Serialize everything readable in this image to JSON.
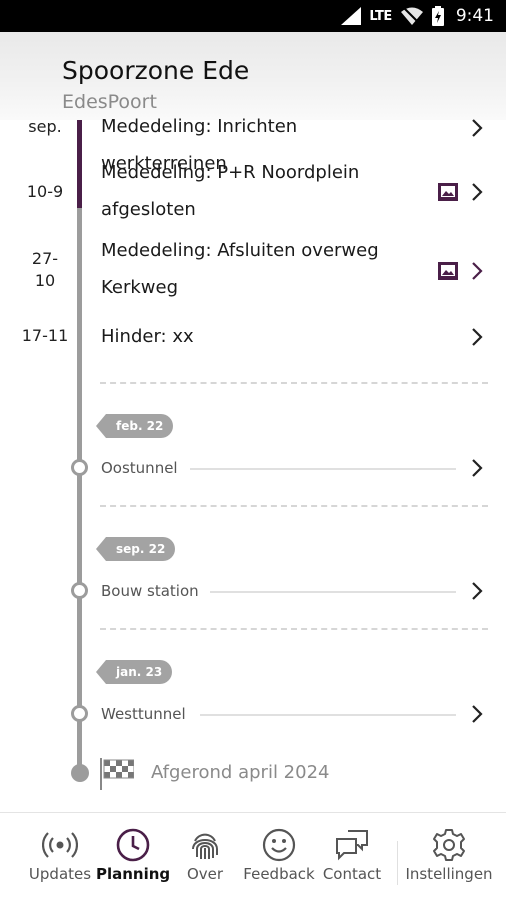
{
  "status_bar": {
    "network": "LTE",
    "time": "9:41"
  },
  "header": {
    "title": "Spoorzone Ede",
    "subtitle": "EdesPoort"
  },
  "updates": [
    {
      "date": "sep.",
      "title": "Mededeling: Inrichten werkterreinen",
      "has_image": false
    },
    {
      "date": "10-9",
      "title_line1": "Mededeling: P+R Noordplein",
      "title_line2": "afgesloten",
      "has_image": true
    },
    {
      "date_line1": "27-",
      "date_line2": "10",
      "title_line1": "Mededeling: Afsluiten overweg",
      "title_line2": "Kerkweg",
      "has_image": true
    },
    {
      "date": "17-11",
      "title": "Hinder: xx",
      "has_image": false
    }
  ],
  "milestones": [
    {
      "tag": "feb. 22",
      "label": "Oostunnel"
    },
    {
      "tag": "sep. 22",
      "label": "Bouw station"
    },
    {
      "tag": "jan. 23",
      "label": "Westtunnel"
    }
  ],
  "finish": {
    "label": "Afgerond april 2024"
  },
  "bottom_nav": {
    "items": [
      {
        "label": "Updates",
        "icon": "broadcast-icon",
        "active": false
      },
      {
        "label": "Planning",
        "icon": "clock-icon",
        "active": true
      },
      {
        "label": "Over",
        "icon": "fingerprint-icon",
        "active": false
      },
      {
        "label": "Feedback",
        "icon": "smiley-icon",
        "active": false
      },
      {
        "label": "Contact",
        "icon": "chat-icon",
        "active": false
      },
      {
        "label": "Instellingen",
        "icon": "gear-icon",
        "active": false
      }
    ]
  },
  "colors": {
    "accent": "#4a1f48",
    "rail": "#9c9c9c",
    "tag": "#a3a3a3"
  }
}
